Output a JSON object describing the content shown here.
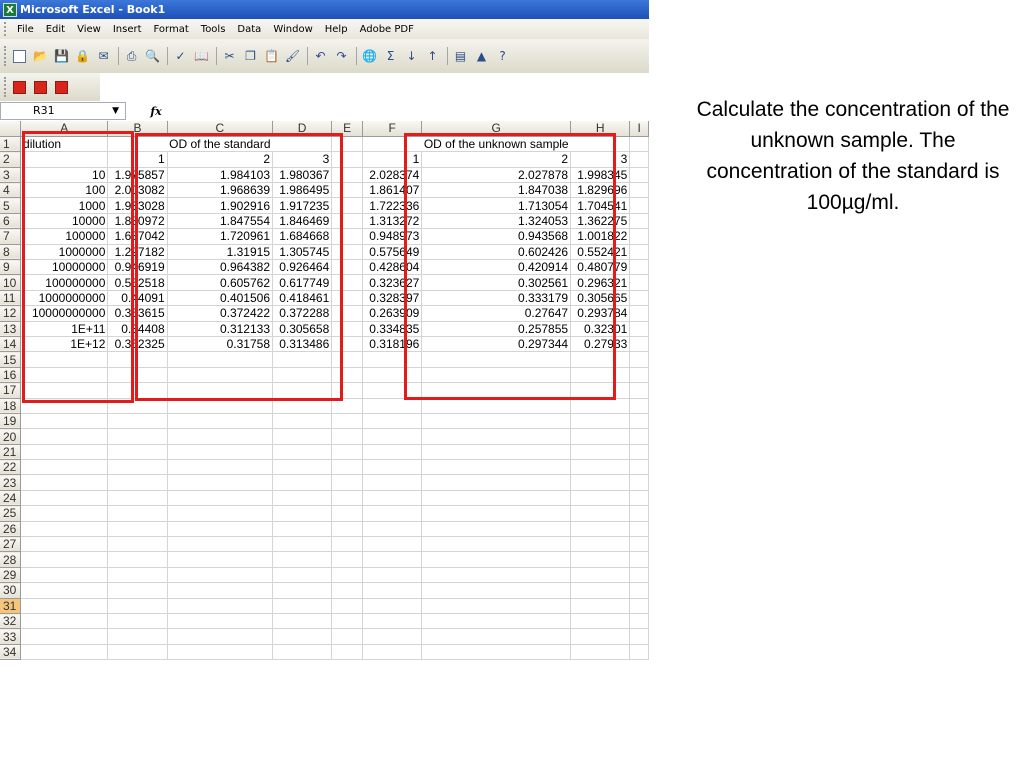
{
  "window": {
    "title": "Microsoft Excel - Book1"
  },
  "menu": [
    "File",
    "Edit",
    "View",
    "Insert",
    "Format",
    "Tools",
    "Data",
    "Window",
    "Help",
    "Adobe PDF"
  ],
  "formula_bar": {
    "cell_ref": "R31",
    "fx": "fx",
    "content": ""
  },
  "columns": [
    "A",
    "B",
    "C",
    "D",
    "E",
    "F",
    "G",
    "H",
    "I"
  ],
  "headers": {
    "dilution": "dilution",
    "standard": "OD of the standard",
    "unknown": "OD of the unknown sample"
  },
  "replicates": [
    "1",
    "2",
    "3"
  ],
  "rows": [
    {
      "dilution": "10",
      "std": [
        "1.975857",
        "1.984103",
        "1.980367"
      ],
      "unk": [
        "2.028374",
        "2.027878",
        "1.998345"
      ]
    },
    {
      "dilution": "100",
      "std": [
        "2.003082",
        "1.968639",
        "1.986495"
      ],
      "unk": [
        "1.861407",
        "1.847038",
        "1.829696"
      ]
    },
    {
      "dilution": "1000",
      "std": [
        "1.933028",
        "1.902916",
        "1.917235"
      ],
      "unk": [
        "1.722336",
        "1.713054",
        "1.704541"
      ]
    },
    {
      "dilution": "10000",
      "std": [
        "1.880972",
        "1.847554",
        "1.846469"
      ],
      "unk": [
        "1.313272",
        "1.324053",
        "1.362275"
      ]
    },
    {
      "dilution": "100000",
      "std": [
        "1.687042",
        "1.720961",
        "1.684668"
      ],
      "unk": [
        "0.948973",
        "0.943568",
        "1.001822"
      ]
    },
    {
      "dilution": "1000000",
      "std": [
        "1.297182",
        "1.31915",
        "1.305745"
      ],
      "unk": [
        "0.575649",
        "0.602426",
        "0.552421"
      ]
    },
    {
      "dilution": "10000000",
      "std": [
        "0.946919",
        "0.964382",
        "0.926464"
      ],
      "unk": [
        "0.428604",
        "0.420914",
        "0.480779"
      ]
    },
    {
      "dilution": "100000000",
      "std": [
        "0.552518",
        "0.605762",
        "0.617749"
      ],
      "unk": [
        "0.323627",
        "0.302561",
        "0.296321"
      ]
    },
    {
      "dilution": "1000000000",
      "std": [
        "0.44091",
        "0.401506",
        "0.418461"
      ],
      "unk": [
        "0.328397",
        "0.333179",
        "0.305665"
      ]
    },
    {
      "dilution": "10000000000",
      "std": [
        "0.353615",
        "0.372422",
        "0.372288"
      ],
      "unk": [
        "0.263909",
        "0.27647",
        "0.293784"
      ]
    },
    {
      "dilution": "1E+11",
      "std": [
        "0.34408",
        "0.312133",
        "0.305658"
      ],
      "unk": [
        "0.334835",
        "0.257855",
        "0.32301"
      ]
    },
    {
      "dilution": "1E+12",
      "std": [
        "0.352325",
        "0.31758",
        "0.313486"
      ],
      "unk": [
        "0.318196",
        "0.297344",
        "0.27933"
      ]
    }
  ],
  "row_count": 34,
  "active_row": 31,
  "side_text": "Calculate the concentration of the unknown sample. The concentration of the standard is 100µg/ml."
}
